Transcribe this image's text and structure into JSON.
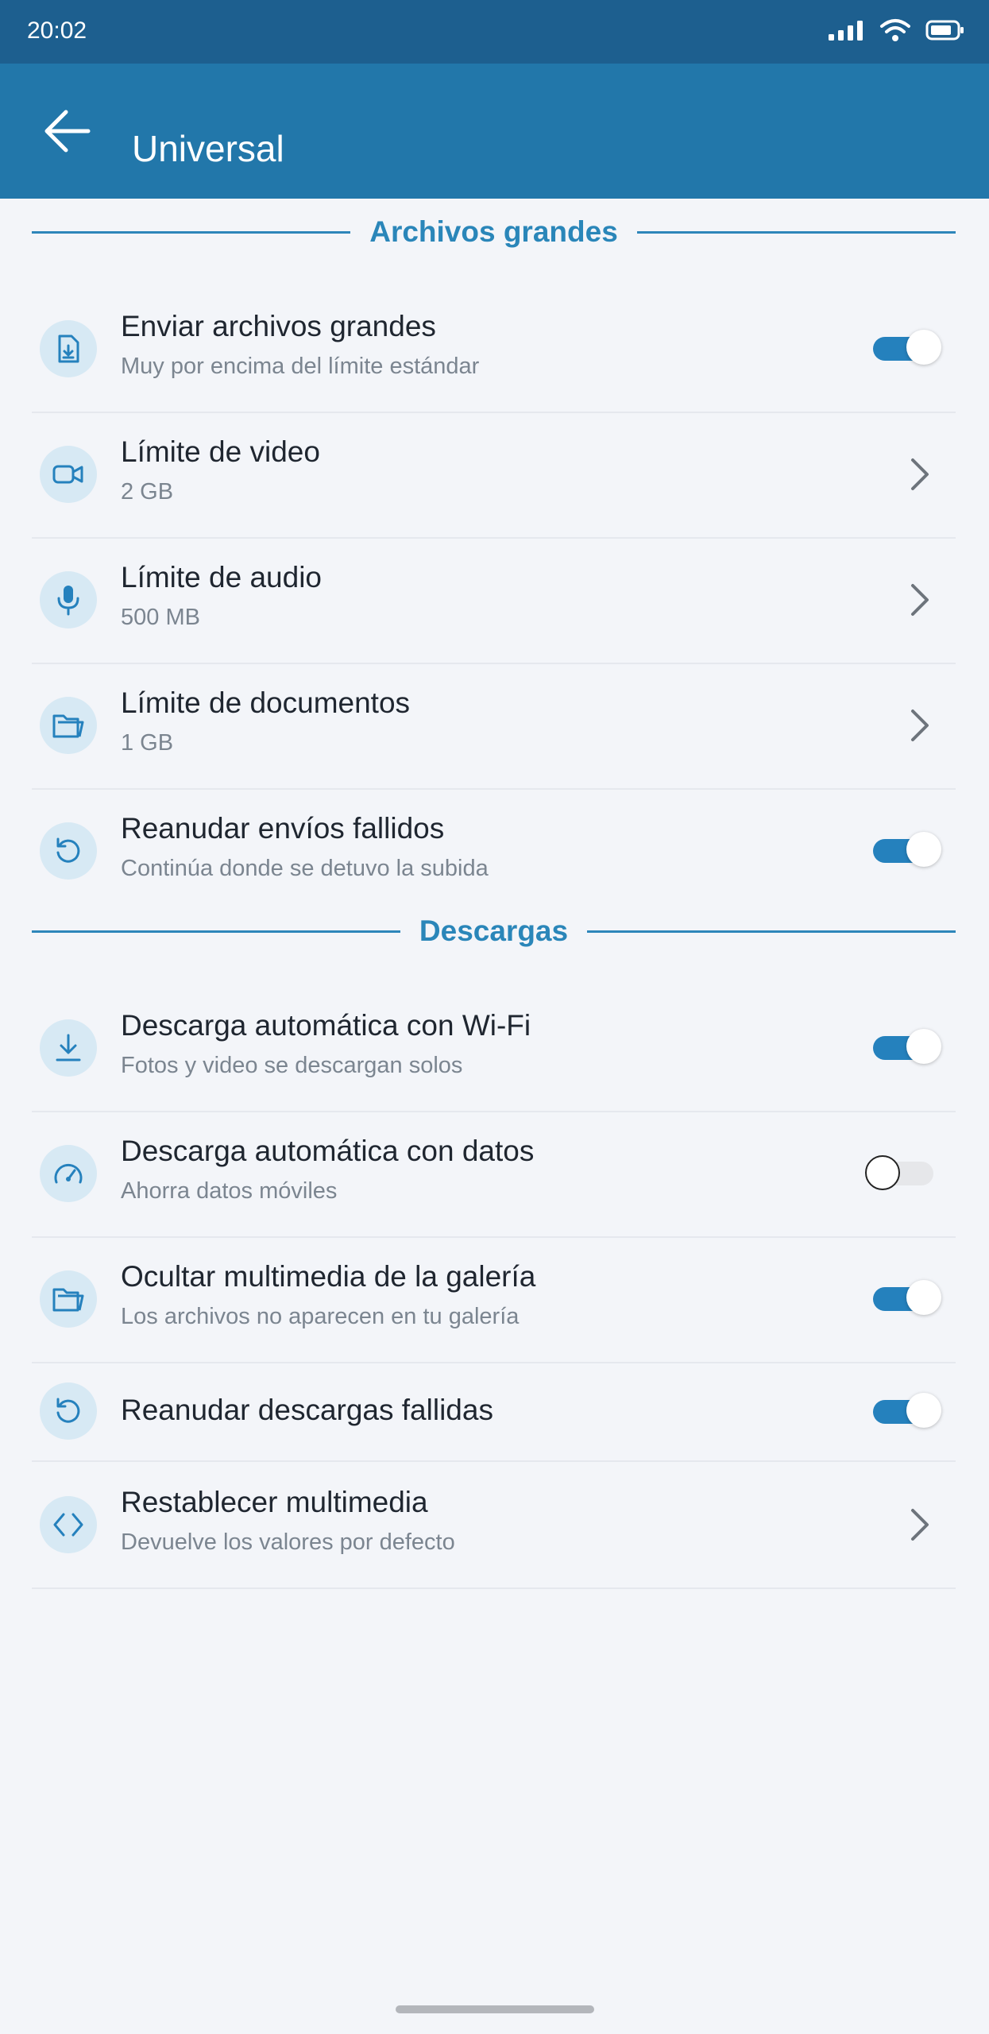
{
  "status_bar": {
    "time": "20:02",
    "icons": [
      "signal-icon",
      "wifi-icon",
      "battery-icon"
    ]
  },
  "app_bar": {
    "back_icon": "arrow-left-icon",
    "title": "Universal"
  },
  "colors": {
    "accent": "#2581bd",
    "app_bar": "#2277aa",
    "status_bar": "#1d5f8f",
    "background": "#f3f5f9",
    "icon_bg": "#d7e9f4"
  },
  "sections": [
    {
      "title": "Archivos grandes",
      "items": [
        {
          "icon": "file-download-icon",
          "title": "Enviar archivos grandes",
          "subtitle": "Muy por encima del límite estándar",
          "control": "toggle",
          "on": true
        },
        {
          "icon": "video-camera-icon",
          "title": "Límite de video",
          "subtitle": "2 GB",
          "control": "chevron"
        },
        {
          "icon": "microphone-icon",
          "title": "Límite de audio",
          "subtitle": "500 MB",
          "control": "chevron"
        },
        {
          "icon": "folder-icon",
          "title": "Límite de documentos",
          "subtitle": "1 GB",
          "control": "chevron"
        },
        {
          "icon": "retry-icon",
          "title": "Reanudar envíos fallidos",
          "subtitle": "Continúa donde se detuvo la subida",
          "control": "toggle",
          "on": true
        }
      ]
    },
    {
      "title": "Descargas",
      "items": [
        {
          "icon": "download-icon",
          "title": "Descarga automática con Wi-Fi",
          "subtitle": "Fotos y video se descargan solos",
          "control": "toggle",
          "on": true
        },
        {
          "icon": "speedometer-icon",
          "title": "Descarga automática con datos",
          "subtitle": "Ahorra datos móviles",
          "control": "toggle",
          "on": false
        },
        {
          "icon": "folder-icon",
          "title": "Ocultar multimedia de la galería",
          "subtitle": "Los archivos no aparecen en tu galería",
          "control": "toggle",
          "on": true
        },
        {
          "icon": "retry-icon",
          "title": "Reanudar descargas fallidas",
          "subtitle": "",
          "control": "toggle",
          "on": true
        },
        {
          "icon": "code-brackets-icon",
          "title": "Restablecer multimedia",
          "subtitle": "Devuelve los valores por defecto",
          "control": "chevron"
        }
      ]
    }
  ]
}
